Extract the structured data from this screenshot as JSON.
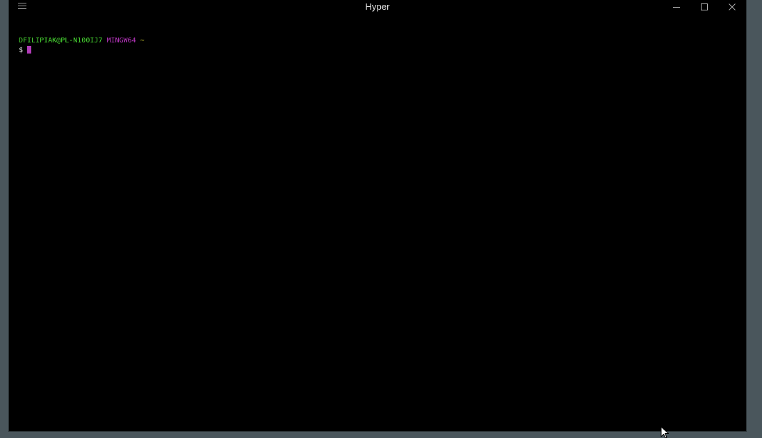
{
  "window": {
    "title": "Hyper"
  },
  "terminal": {
    "user_host": "DFILIPIAK@PL-N100IJ7",
    "env": "MINGW64",
    "cwd": "~",
    "prompt_symbol": "$"
  },
  "colors": {
    "user_host": "#4be034",
    "env": "#c238c8",
    "cwd": "#d0cf2f",
    "cursor": "#b13bb8",
    "background": "#000000",
    "desktop": "#4a565c"
  },
  "icons": {
    "menu": "hamburger-icon",
    "minimize": "minimize-icon",
    "maximize": "maximize-icon",
    "close": "close-icon",
    "pointer": "mouse-pointer-icon"
  }
}
